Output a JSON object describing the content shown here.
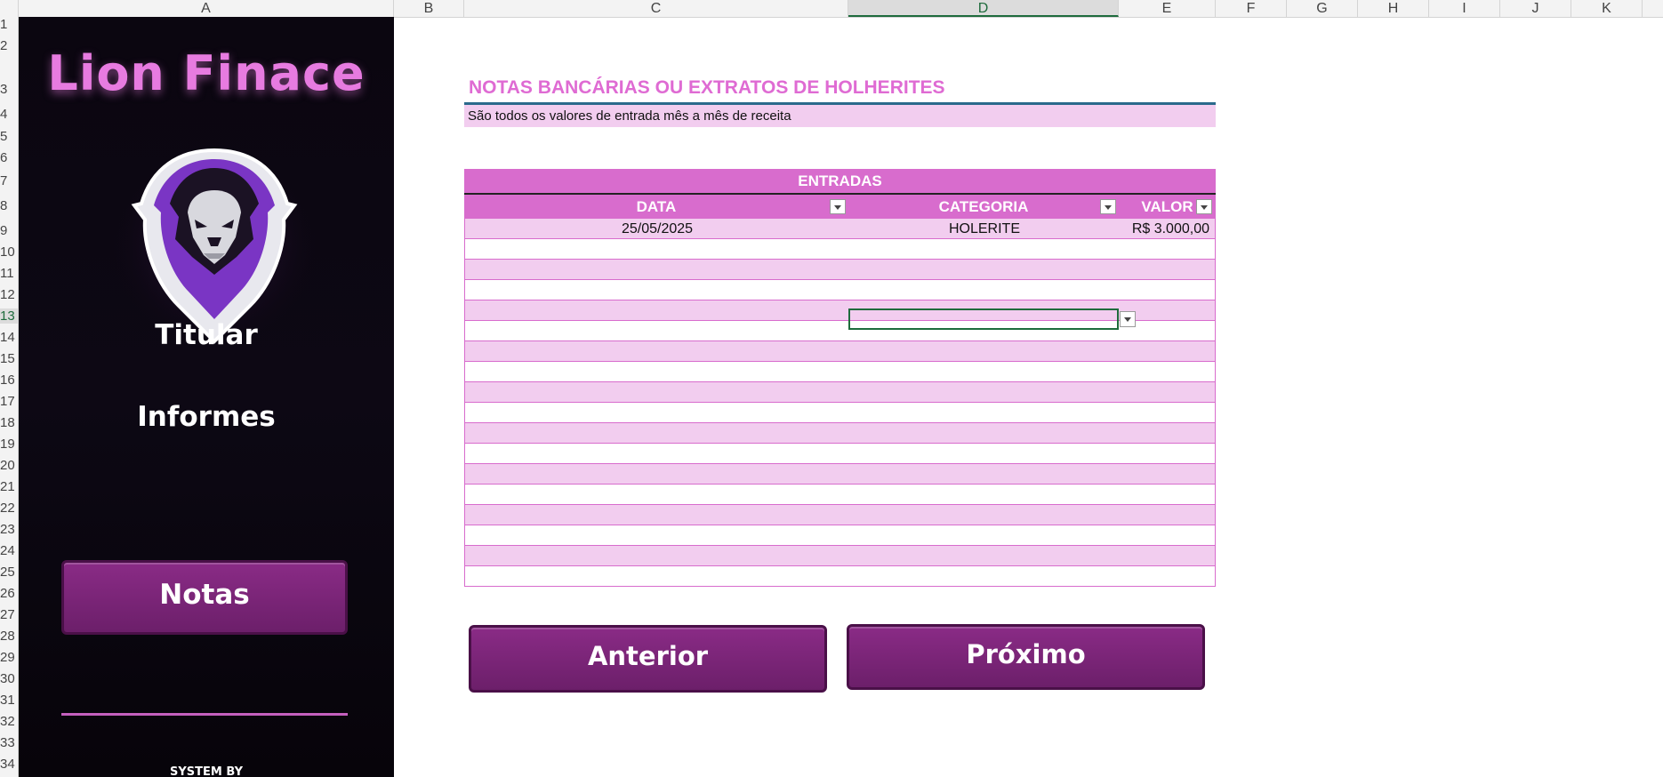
{
  "columns": [
    "A",
    "B",
    "C",
    "D",
    "E",
    "F",
    "G",
    "H",
    "I",
    "J",
    "K"
  ],
  "selected_column": "D",
  "rows": [
    "1",
    "2",
    "3",
    "4",
    "5",
    "6",
    "7",
    "8",
    "9",
    "10",
    "11",
    "12",
    "13",
    "14",
    "15",
    "16",
    "17",
    "18",
    "19",
    "20",
    "21",
    "22",
    "23",
    "24",
    "25",
    "26",
    "27",
    "28",
    "29",
    "30",
    "31",
    "32",
    "33",
    "34"
  ],
  "selected_row": "13",
  "sidebar": {
    "brand": "Lion Finace",
    "logo_icon": "lion-logo-icon",
    "menu": [
      {
        "label": "Titular"
      },
      {
        "label": "Informes"
      },
      {
        "label": "Notas",
        "active": true
      }
    ],
    "footer": "SYSTEM BY"
  },
  "main": {
    "title": "NOTAS BANCÁRIAS OU EXTRATOS DE HOLHERITES",
    "subtitle": "São todos os valores de entrada mês a mês de receita",
    "table": {
      "header": "ENTRADAS",
      "columns": [
        "DATA",
        "CATEGORIA",
        "VALOR"
      ],
      "rows": [
        {
          "data": "25/05/2025",
          "categoria": "HOLERITE",
          "valor": "R$ 3.000,00"
        }
      ]
    },
    "buttons": {
      "prev": "Anterior",
      "next": "Próximo"
    }
  },
  "colors": {
    "accent": "#df6bd3",
    "button": "#7a2577",
    "row_alt": "#f2cdef"
  }
}
